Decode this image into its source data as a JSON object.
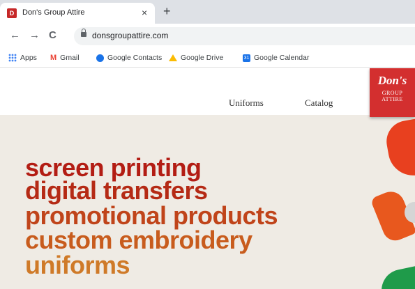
{
  "browser": {
    "tab": {
      "title": "Don's Group Attire",
      "favicon": "D",
      "close": "×"
    },
    "new_tab": "+",
    "nav": {
      "back": "←",
      "forward": "→",
      "reload": "C"
    },
    "url": "donsgroupattire.com",
    "bookmarks": [
      {
        "label": "Apps",
        "icon": "apps-grid-icon"
      },
      {
        "label": "Gmail",
        "icon": "gmail-icon",
        "glyph": "M"
      },
      {
        "label": "Google Contacts",
        "icon": "contacts-icon"
      },
      {
        "label": "Google Drive",
        "icon": "drive-icon"
      },
      {
        "label": "Google Calendar",
        "icon": "calendar-icon",
        "glyph": "31"
      }
    ]
  },
  "site": {
    "nav": [
      "Uniforms",
      "Catalog"
    ],
    "logo": {
      "main": "Don's",
      "line1": "GROUP",
      "line2": "ATTIRE"
    },
    "hero_lines": [
      {
        "text": "screen printing",
        "color": "#b31d14"
      },
      {
        "text": "digital transfers",
        "color": "#b52a15"
      },
      {
        "text": "promotional products",
        "color": "#c0441a"
      },
      {
        "text": "custom embroidery",
        "color": "#c85c1d"
      },
      {
        "text": "uniforms",
        "color": "#cf7a28"
      }
    ],
    "colors": {
      "brand": "#d32f2f",
      "hero_bg": "#efebe4"
    }
  }
}
